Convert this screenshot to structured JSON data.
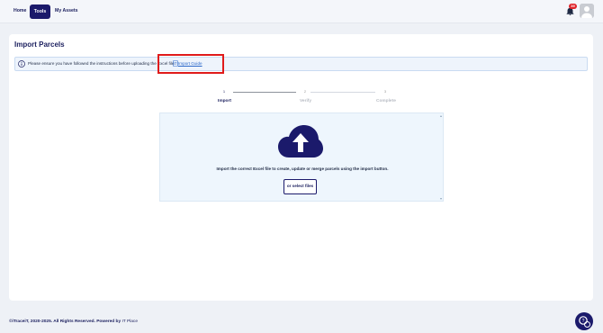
{
  "nav": {
    "home": "Home",
    "tools": "Tools",
    "assets": "My Assets",
    "notification_count": "39"
  },
  "page": {
    "title": "Import Parcels",
    "info_text": "Please ensure you have followed the instructions before uploading the Excel file.",
    "guide_link": "Import Guide"
  },
  "stepper": {
    "steps": [
      {
        "number": "1",
        "label": "Import",
        "active": true
      },
      {
        "number": "2",
        "label": "Verify",
        "active": false
      },
      {
        "number": "3",
        "label": "Complete",
        "active": false
      }
    ]
  },
  "dropzone": {
    "instruction": "Import the correct Excel file to create, update or merge parcels using the import button.",
    "select_button": "or select files"
  },
  "footer": {
    "copyright": "©iTraceiT, 2020-2025. All Rights Reserved. Powered by",
    "powered_by": "IT Place"
  },
  "colors": {
    "brand": "#1b1a6b",
    "highlight": "#e01b1b",
    "badge": "#e0252b",
    "link": "#2a67c9"
  },
  "icons": [
    "bell-icon",
    "avatar-icon",
    "info-icon",
    "document-icon",
    "cloud-upload-icon",
    "help-chat-icon"
  ]
}
